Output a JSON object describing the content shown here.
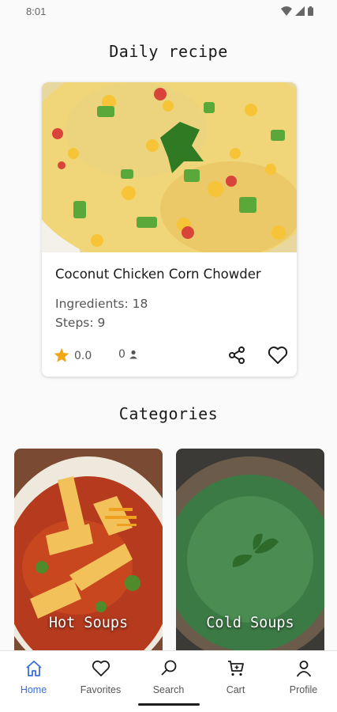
{
  "status_bar": {
    "time": "8:01"
  },
  "daily": {
    "section_title": "Daily recipe",
    "recipe": {
      "name": "Coconut Chicken Corn Chowder",
      "ingredients": "Ingredients: 18",
      "steps": "Steps: 9",
      "rating": "0.0",
      "reviews": "0"
    }
  },
  "categories": {
    "section_title": "Categories",
    "items": [
      {
        "label": "Hot Soups"
      },
      {
        "label": "Cold Soups"
      }
    ]
  },
  "nav": {
    "items": [
      {
        "label": "Home",
        "icon": "home-icon",
        "active": true
      },
      {
        "label": "Favorites",
        "icon": "heart-icon"
      },
      {
        "label": "Search",
        "icon": "search-icon"
      },
      {
        "label": "Cart",
        "icon": "cart-icon"
      },
      {
        "label": "Profile",
        "icon": "person-icon"
      }
    ]
  },
  "colors": {
    "accent": "#3a6fd8",
    "star": "#f2a516"
  }
}
